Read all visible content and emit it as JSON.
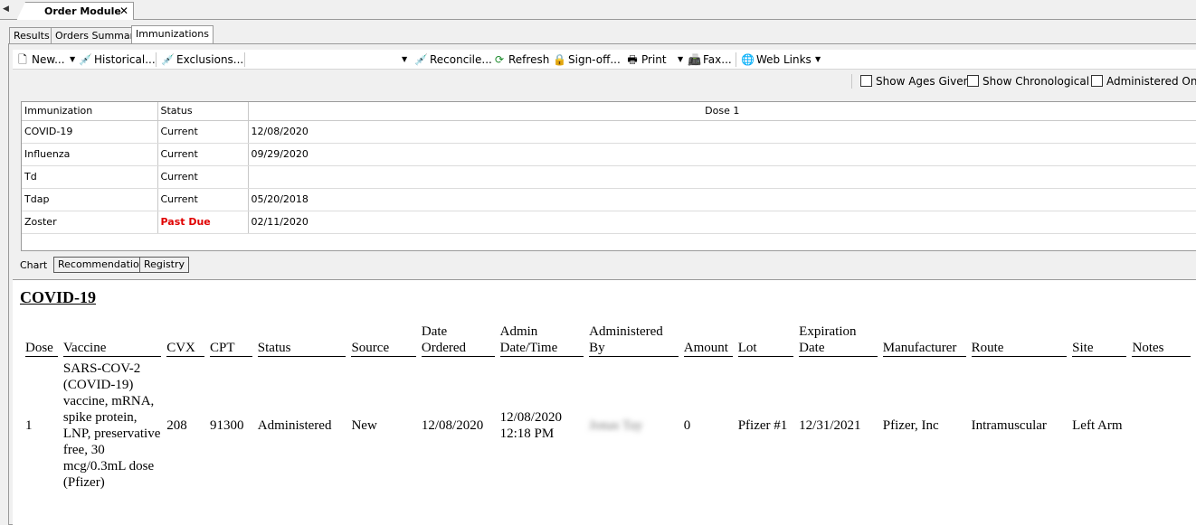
{
  "doc_tabs": [
    {
      "label": "Order Module"
    }
  ],
  "sub_tabs": [
    {
      "label": "Results"
    },
    {
      "label": "Orders Summary"
    },
    {
      "label": "Immunizations"
    }
  ],
  "toolbar": {
    "new_label": "New...",
    "historical_label": "Historical...",
    "exclusions_label": "Exclusions...",
    "reconcile_label": "Reconcile...",
    "refresh_label": "Refresh",
    "signoff_label": "Sign-off...",
    "print_label": "Print",
    "fax_label": "Fax...",
    "weblinks_label": "Web Links"
  },
  "filters": [
    {
      "label": "Show Ages Given",
      "checked": false
    },
    {
      "label": "Show Chronological",
      "checked": false
    },
    {
      "label": "Administered Only",
      "checked": false
    }
  ],
  "grid": {
    "headers": [
      "Immunization",
      "Status",
      "Dose 1"
    ],
    "rows": [
      {
        "name": "COVID-19",
        "status": "Current",
        "dose1": "12/08/2020"
      },
      {
        "name": "Influenza",
        "status": "Current",
        "dose1": "09/29/2020"
      },
      {
        "name": "Td",
        "status": "Current",
        "dose1": ""
      },
      {
        "name": "Tdap",
        "status": "Current",
        "dose1": "05/20/2018"
      },
      {
        "name": "Zoster",
        "status": "Past Due",
        "dose1": "02/11/2020"
      }
    ]
  },
  "bottom_tabs": [
    {
      "label": "Chart"
    },
    {
      "label": "Recommendation"
    },
    {
      "label": "Registry"
    }
  ],
  "detail": {
    "title": "COVID-19",
    "headers": {
      "dose": "Dose",
      "vaccine": "Vaccine",
      "cvx": "CVX",
      "cpt": "CPT",
      "status": "Status",
      "source": "Source",
      "date_ordered": "Date Ordered",
      "admin_datetime": "Admin Date/Time",
      "administered_by": "Administered By",
      "amount": "Amount",
      "lot": "Lot",
      "expiration": "Expiration Date",
      "manufacturer": "Manufacturer",
      "route": "Route",
      "site": "Site",
      "notes": "Notes"
    },
    "row": {
      "dose": "1",
      "vaccine": "SARS-COV-2 (COVID-19) vaccine, mRNA, spike protein, LNP, preservative free, 30 mcg/0.3mL dose (Pfizer)",
      "cvx": "208",
      "cpt": "91300",
      "status": "Administered",
      "source": "New",
      "date_ordered": "12/08/2020",
      "admin_datetime": "12/08/2020 12:18 PM",
      "administered_by": "Jonas Tay",
      "amount": "0",
      "lot": "Pfizer #1",
      "expiration": "12/31/2021",
      "manufacturer": "Pfizer, Inc",
      "route": "Intramuscular",
      "site": "Left Arm",
      "notes": ""
    }
  },
  "colors": {
    "past_due": "#e00000"
  }
}
